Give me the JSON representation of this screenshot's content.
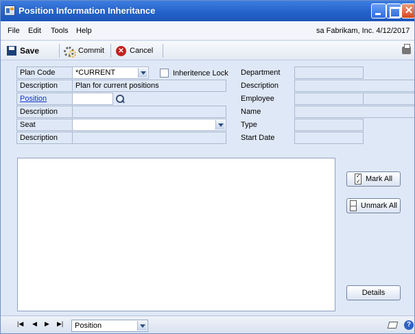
{
  "window": {
    "title": "Position Information Inheritance"
  },
  "menu": {
    "items": [
      "File",
      "Edit",
      "Tools",
      "Help"
    ],
    "status": "sa  Fabrikam, Inc.  4/12/2017"
  },
  "toolbar": {
    "save_label": "Save",
    "commit_label": "Commit",
    "cancel_label": "Cancel"
  },
  "form": {
    "plan_code_label": "Plan Code",
    "plan_code_value": "*CURRENT",
    "inheritance_lock_label": "Inheritence Lock",
    "description_label": "Description",
    "plan_description_value": "Plan for current positions",
    "position_label": "Position",
    "position_value": "",
    "position_description_label": "Description",
    "seat_label": "Seat",
    "seat_value": "",
    "seat_description_label": "Description",
    "department_label": "Department",
    "dept_description_label": "Description",
    "employee_label": "Employee",
    "name_label": "Name",
    "type_label": "Type",
    "start_date_label": "Start Date"
  },
  "buttons": {
    "mark_all": "Mark All",
    "unmark_all": "Unmark All",
    "details": "Details"
  },
  "bottom": {
    "nav": [
      "|◀",
      "◀",
      "▶",
      "▶|"
    ],
    "browse_by_value": "Position"
  },
  "icons": {
    "window": "window-app-icon",
    "save": "save-icon",
    "commit": "commit-icon",
    "cancel": "cancel-icon",
    "print": "printer-icon",
    "lookup": "lookup-icon",
    "note": "note-icon",
    "help": "help-icon"
  }
}
